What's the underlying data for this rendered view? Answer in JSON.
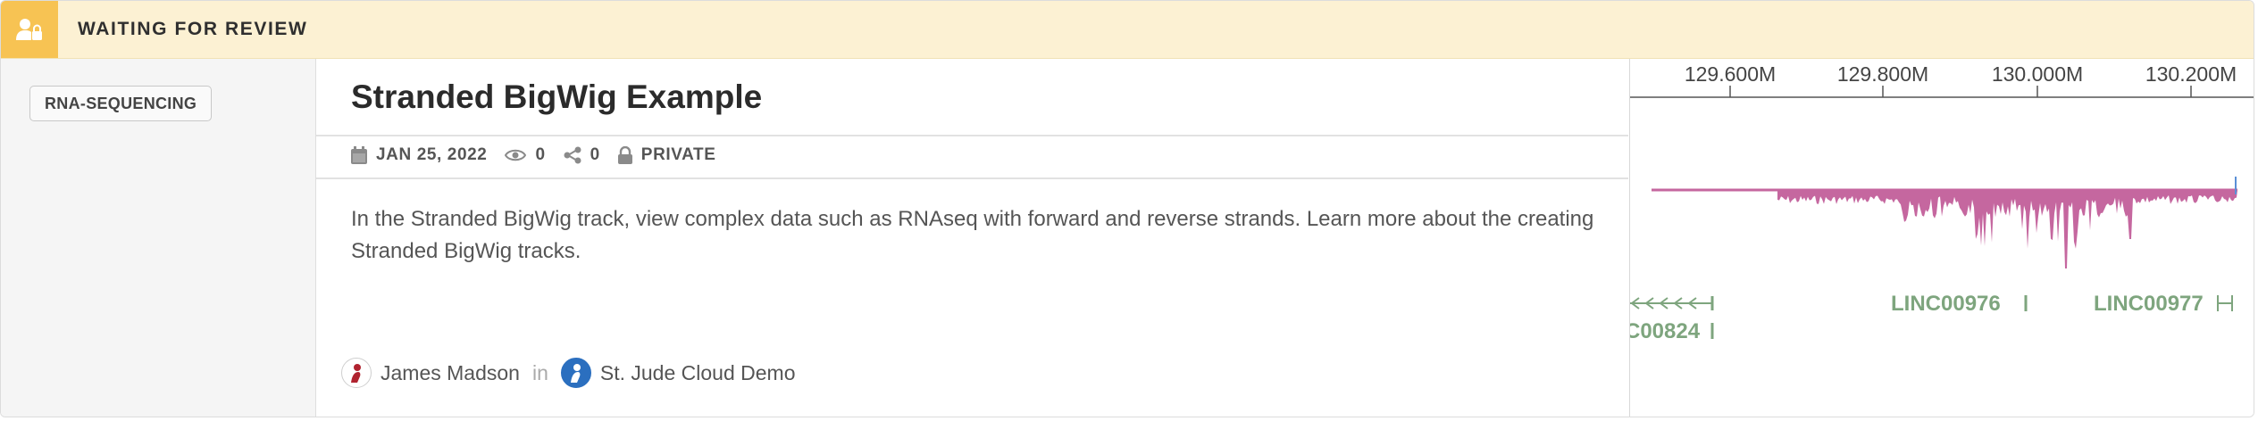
{
  "status": {
    "label": "WAITING FOR REVIEW",
    "icon": "user-lock-icon",
    "color": "#f7c353"
  },
  "sidebar": {
    "tag": "RNA-SEQUENCING"
  },
  "card": {
    "title": "Stranded BigWig Example",
    "meta": {
      "date": "JAN 25, 2022",
      "views": "0",
      "shares": "0",
      "visibility": "PRIVATE"
    },
    "description": "In the Stranded BigWig track, view complex data such as RNAseq with forward and reverse strands. Learn more about the creating Stranded BigWig tracks.",
    "author": "James Madson",
    "in_label": "in",
    "organization": "St. Jude Cloud Demo"
  },
  "track": {
    "ticks": [
      "129.600M",
      "129.800M",
      "130.000M",
      "130.200M"
    ],
    "genes": [
      "C00824",
      "LINC00976",
      "LINC00977"
    ],
    "signal_color": "#c5679f",
    "gene_color": "#7ea57e"
  }
}
